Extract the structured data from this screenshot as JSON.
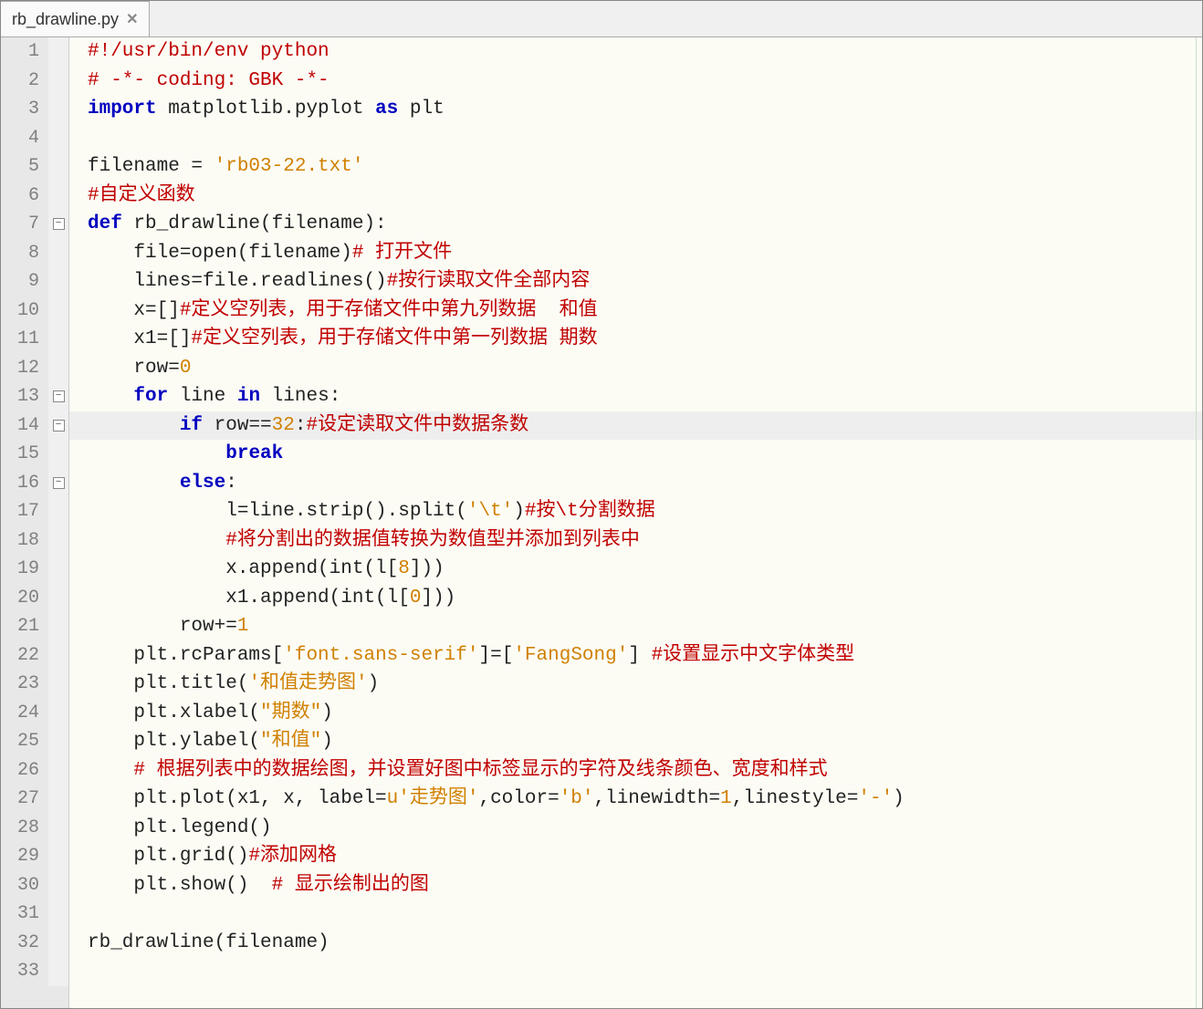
{
  "tab": {
    "filename": "rb_drawline.py",
    "close_glyph": "✕"
  },
  "lines": [
    {
      "num": 1,
      "fold": "",
      "tokens": [
        [
          "comment",
          "#!/usr/bin/env python"
        ]
      ]
    },
    {
      "num": 2,
      "fold": "",
      "tokens": [
        [
          "comment",
          "# -*- coding: GBK -*-"
        ]
      ]
    },
    {
      "num": 3,
      "fold": "",
      "tokens": [
        [
          "keyword",
          "import"
        ],
        [
          "default",
          " matplotlib.pyplot "
        ],
        [
          "keyword",
          "as"
        ],
        [
          "default",
          " plt"
        ]
      ]
    },
    {
      "num": 4,
      "fold": "",
      "tokens": [
        [
          "default",
          ""
        ]
      ]
    },
    {
      "num": 5,
      "fold": "",
      "tokens": [
        [
          "default",
          "filename = "
        ],
        [
          "string",
          "'rb03-22.txt'"
        ]
      ]
    },
    {
      "num": 6,
      "fold": "",
      "tokens": [
        [
          "comment",
          "#自定义函数"
        ]
      ]
    },
    {
      "num": 7,
      "fold": "box",
      "tokens": [
        [
          "keyword",
          "def"
        ],
        [
          "default",
          " rb_drawline(filename):"
        ]
      ]
    },
    {
      "num": 8,
      "fold": "",
      "tokens": [
        [
          "default",
          "    file=open(filename)"
        ],
        [
          "comment",
          "# 打开文件"
        ]
      ]
    },
    {
      "num": 9,
      "fold": "",
      "tokens": [
        [
          "default",
          "    lines=file.readlines()"
        ],
        [
          "comment",
          "#按行读取文件全部内容"
        ]
      ]
    },
    {
      "num": 10,
      "fold": "",
      "tokens": [
        [
          "default",
          "    x=[]"
        ],
        [
          "comment",
          "#定义空列表，用于存储文件中第九列数据  和值"
        ]
      ]
    },
    {
      "num": 11,
      "fold": "",
      "tokens": [
        [
          "default",
          "    x1=[]"
        ],
        [
          "comment",
          "#定义空列表，用于存储文件中第一列数据 期数"
        ]
      ]
    },
    {
      "num": 12,
      "fold": "",
      "tokens": [
        [
          "default",
          "    row="
        ],
        [
          "number",
          "0"
        ]
      ]
    },
    {
      "num": 13,
      "fold": "box",
      "tokens": [
        [
          "default",
          "    "
        ],
        [
          "keyword",
          "for"
        ],
        [
          "default",
          " line "
        ],
        [
          "keyword",
          "in"
        ],
        [
          "default",
          " lines:"
        ]
      ]
    },
    {
      "num": 14,
      "fold": "box",
      "highlight": true,
      "tokens": [
        [
          "default",
          "        "
        ],
        [
          "keyword",
          "if"
        ],
        [
          "default",
          " row=="
        ],
        [
          "number",
          "32"
        ],
        [
          "default",
          ":"
        ],
        [
          "comment",
          "#设定读取文件中数据条数"
        ]
      ]
    },
    {
      "num": 15,
      "fold": "",
      "tokens": [
        [
          "default",
          "            "
        ],
        [
          "keyword",
          "break"
        ]
      ]
    },
    {
      "num": 16,
      "fold": "box",
      "tokens": [
        [
          "default",
          "        "
        ],
        [
          "keyword",
          "else"
        ],
        [
          "default",
          ":"
        ]
      ]
    },
    {
      "num": 17,
      "fold": "",
      "tokens": [
        [
          "default",
          "            l=line.strip().split("
        ],
        [
          "string",
          "'\\t'"
        ],
        [
          "default",
          ")"
        ],
        [
          "comment",
          "#按\\t分割数据"
        ]
      ]
    },
    {
      "num": 18,
      "fold": "",
      "tokens": [
        [
          "default",
          "            "
        ],
        [
          "comment",
          "#将分割出的数据值转换为数值型并添加到列表中"
        ]
      ]
    },
    {
      "num": 19,
      "fold": "",
      "tokens": [
        [
          "default",
          "            x.append(int(l["
        ],
        [
          "number",
          "8"
        ],
        [
          "default",
          "]))"
        ]
      ]
    },
    {
      "num": 20,
      "fold": "",
      "tokens": [
        [
          "default",
          "            x1.append(int(l["
        ],
        [
          "number",
          "0"
        ],
        [
          "default",
          "]))"
        ]
      ]
    },
    {
      "num": 21,
      "fold": "",
      "tokens": [
        [
          "default",
          "        row+="
        ],
        [
          "number",
          "1"
        ]
      ]
    },
    {
      "num": 22,
      "fold": "",
      "tokens": [
        [
          "default",
          "    plt.rcParams["
        ],
        [
          "string",
          "'font.sans-serif'"
        ],
        [
          "default",
          "]=["
        ],
        [
          "string",
          "'FangSong'"
        ],
        [
          "default",
          "] "
        ],
        [
          "comment",
          "#设置显示中文字体类型"
        ]
      ]
    },
    {
      "num": 23,
      "fold": "",
      "tokens": [
        [
          "default",
          "    plt.title("
        ],
        [
          "string",
          "'和值走势图'"
        ],
        [
          "default",
          ")"
        ]
      ]
    },
    {
      "num": 24,
      "fold": "",
      "tokens": [
        [
          "default",
          "    plt.xlabel("
        ],
        [
          "string",
          "\"期数\""
        ],
        [
          "default",
          ")"
        ]
      ]
    },
    {
      "num": 25,
      "fold": "",
      "tokens": [
        [
          "default",
          "    plt.ylabel("
        ],
        [
          "string",
          "\"和值\""
        ],
        [
          "default",
          ")"
        ]
      ]
    },
    {
      "num": 26,
      "fold": "",
      "tokens": [
        [
          "default",
          "    "
        ],
        [
          "comment",
          "# 根据列表中的数据绘图，并设置好图中标签显示的字符及线条颜色、宽度和样式"
        ]
      ]
    },
    {
      "num": 27,
      "fold": "",
      "tokens": [
        [
          "default",
          "    plt.plot(x1, x, label="
        ],
        [
          "string",
          "u'走势图'"
        ],
        [
          "default",
          ",color="
        ],
        [
          "string",
          "'b'"
        ],
        [
          "default",
          ",linewidth="
        ],
        [
          "number",
          "1"
        ],
        [
          "default",
          ",linestyle="
        ],
        [
          "string",
          "'-'"
        ],
        [
          "default",
          ")"
        ]
      ]
    },
    {
      "num": 28,
      "fold": "",
      "tokens": [
        [
          "default",
          "    plt.legend()"
        ]
      ]
    },
    {
      "num": 29,
      "fold": "",
      "tokens": [
        [
          "default",
          "    plt.grid()"
        ],
        [
          "comment",
          "#添加网格"
        ]
      ]
    },
    {
      "num": 30,
      "fold": "",
      "tokens": [
        [
          "default",
          "    plt.show()  "
        ],
        [
          "comment",
          "# 显示绘制出的图"
        ]
      ]
    },
    {
      "num": 31,
      "fold": "",
      "tokens": [
        [
          "default",
          ""
        ]
      ]
    },
    {
      "num": 32,
      "fold": "",
      "tokens": [
        [
          "default",
          "rb_drawline(filename)"
        ]
      ]
    },
    {
      "num": 33,
      "fold": "",
      "tokens": [
        [
          "default",
          ""
        ]
      ]
    }
  ]
}
